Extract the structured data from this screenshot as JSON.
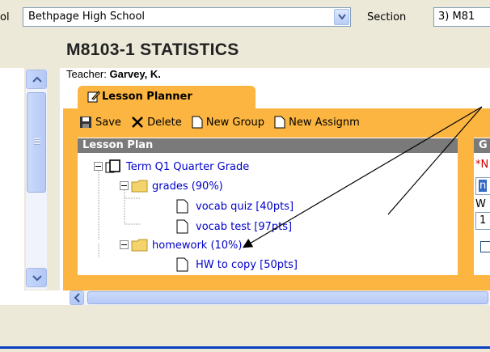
{
  "school_select": {
    "label_fragment": "ol",
    "value": "Bethpage High School"
  },
  "section_select": {
    "label": "Section",
    "value": "3) M81"
  },
  "course": {
    "title": "M8103-1 STATISTICS",
    "teacher_label": "Teacher:",
    "teacher_name": "Garvey, K."
  },
  "tab": {
    "label": "Lesson Planner"
  },
  "toolbar": {
    "save": "Save",
    "delete": "Delete",
    "new_group": "New Group",
    "new_assignment": "New Assignm"
  },
  "lesson_plan": {
    "header": "Lesson Plan",
    "tree": [
      {
        "label": "Term Q1 Quarter Grade",
        "type": "root"
      },
      {
        "label": "grades (90%)",
        "type": "folder"
      },
      {
        "label": "vocab quiz [40pts]",
        "type": "file"
      },
      {
        "label": "vocab test [97pts]",
        "type": "file"
      },
      {
        "label": "homework (10%)",
        "type": "folder"
      },
      {
        "label": "HW to copy [50pts]",
        "type": "file"
      }
    ]
  },
  "right_panel": {
    "header": "G",
    "required_fragment": "*N",
    "field_value": "n",
    "label_fragment": "W",
    "value2": "1"
  },
  "colors": {
    "accent_orange": "#fbb540",
    "link_blue": "#0000cc",
    "header_gray": "#7a7a7a",
    "arrow": "#000000"
  }
}
